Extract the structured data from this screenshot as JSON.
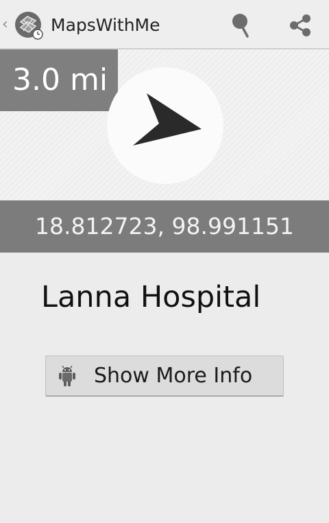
{
  "action_bar": {
    "title": "MapsWithMe",
    "icons": [
      "up-caret-icon",
      "app-logo-icon",
      "pin-icon",
      "share-icon"
    ]
  },
  "compass": {
    "distance": "3.0 mi",
    "arrow_icon": "direction-arrow-icon"
  },
  "coordinates": "18.812723, 98.991151",
  "place": {
    "name": "Lanna Hospital"
  },
  "more_info_button": {
    "label": "Show More Info",
    "icon": "android-robot-icon"
  }
}
